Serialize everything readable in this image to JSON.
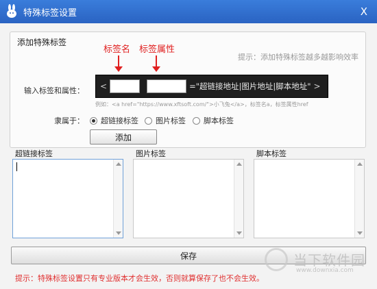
{
  "window": {
    "title": "特殊标签设置",
    "close_label": "X"
  },
  "top_group": {
    "title": "添加特殊标签",
    "hint": "提示：添加特殊标签越多越影响效率",
    "annotations": {
      "tag_name": "标签名",
      "tag_attr": "标签属性"
    },
    "input_label": "输入标签和属性：",
    "code": {
      "open": "<",
      "rest": "=\"超链接地址|图片地址|脚本地址\"",
      "close": ">"
    },
    "example": "例如：<a href=\"https://www.xftsoft.com/\">小飞兔</a>，标签名a，标签属性href",
    "belong_label": "隶属于：",
    "radios": [
      {
        "label": "超链接标签",
        "selected": true
      },
      {
        "label": "图片标签",
        "selected": false
      },
      {
        "label": "脚本标签",
        "selected": false
      }
    ],
    "add_button": "添加"
  },
  "lists": [
    {
      "title": "超链接标签"
    },
    {
      "title": "图片标签"
    },
    {
      "title": "脚本标签"
    }
  ],
  "save_button": "保存",
  "warning": "提示：特殊标签设置只有专业版本才会生效，否则就算保存了也不会生效。",
  "watermark": {
    "text": "当下软件园",
    "url": "www.downxia.com"
  },
  "colors": {
    "titlebar": "#2f6fd0",
    "annotation": "#e02020",
    "warning": "#e03030"
  }
}
